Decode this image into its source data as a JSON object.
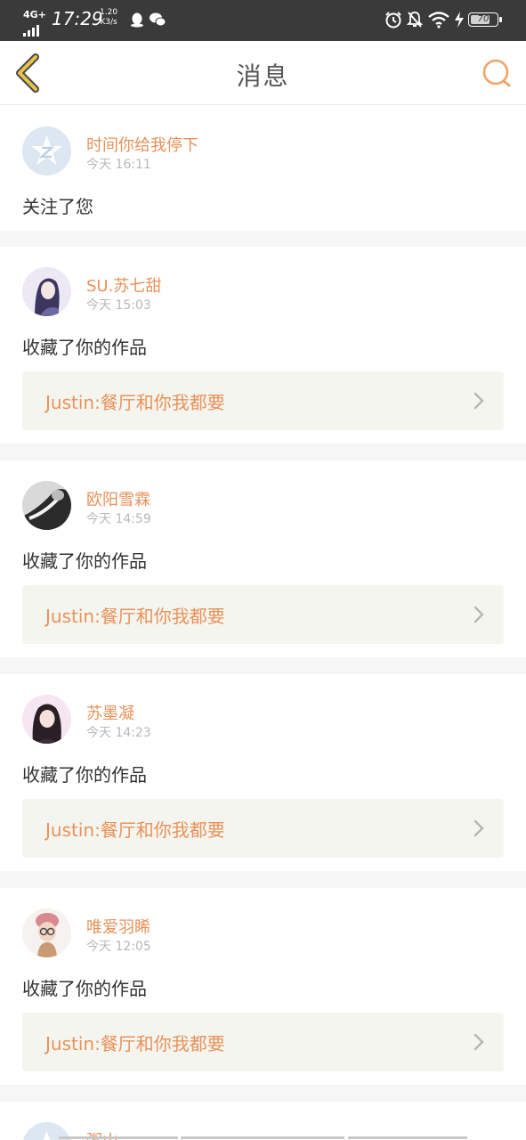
{
  "status_bar": {
    "network": "4G+",
    "time": "17:29",
    "speed_value": "1.20",
    "speed_unit": "K3/s",
    "battery": "70"
  },
  "header": {
    "title": "消息"
  },
  "messages": [
    {
      "name": "时间你给我停下",
      "time": "今天 16:11",
      "action": "关注了您",
      "work": ""
    },
    {
      "name": "SU.苏七甜",
      "time": "今天 15:03",
      "action": "收藏了你的作品",
      "work": "Justin:餐厅和你我都要"
    },
    {
      "name": "欧阳雪霖",
      "time": "今天 14:59",
      "action": "收藏了你的作品",
      "work": "Justin:餐厅和你我都要"
    },
    {
      "name": "苏墨凝",
      "time": "今天 14:23",
      "action": "收藏了你的作品",
      "work": "Justin:餐厅和你我都要"
    },
    {
      "name": "唯爱羽睎",
      "time": "今天 12:05",
      "action": "收藏了你的作品",
      "work": "Justin:餐厅和你我都要"
    },
    {
      "name": "粥山",
      "time": "",
      "action": "",
      "work": ""
    }
  ],
  "colors": {
    "accent": "#e8925a",
    "back_arrow": "#e8c24a",
    "status_bar": "#3a3a3a"
  },
  "icons": {
    "back": "back-arrow-icon",
    "search": "search-icon",
    "chevron": "chevron-right-icon"
  }
}
